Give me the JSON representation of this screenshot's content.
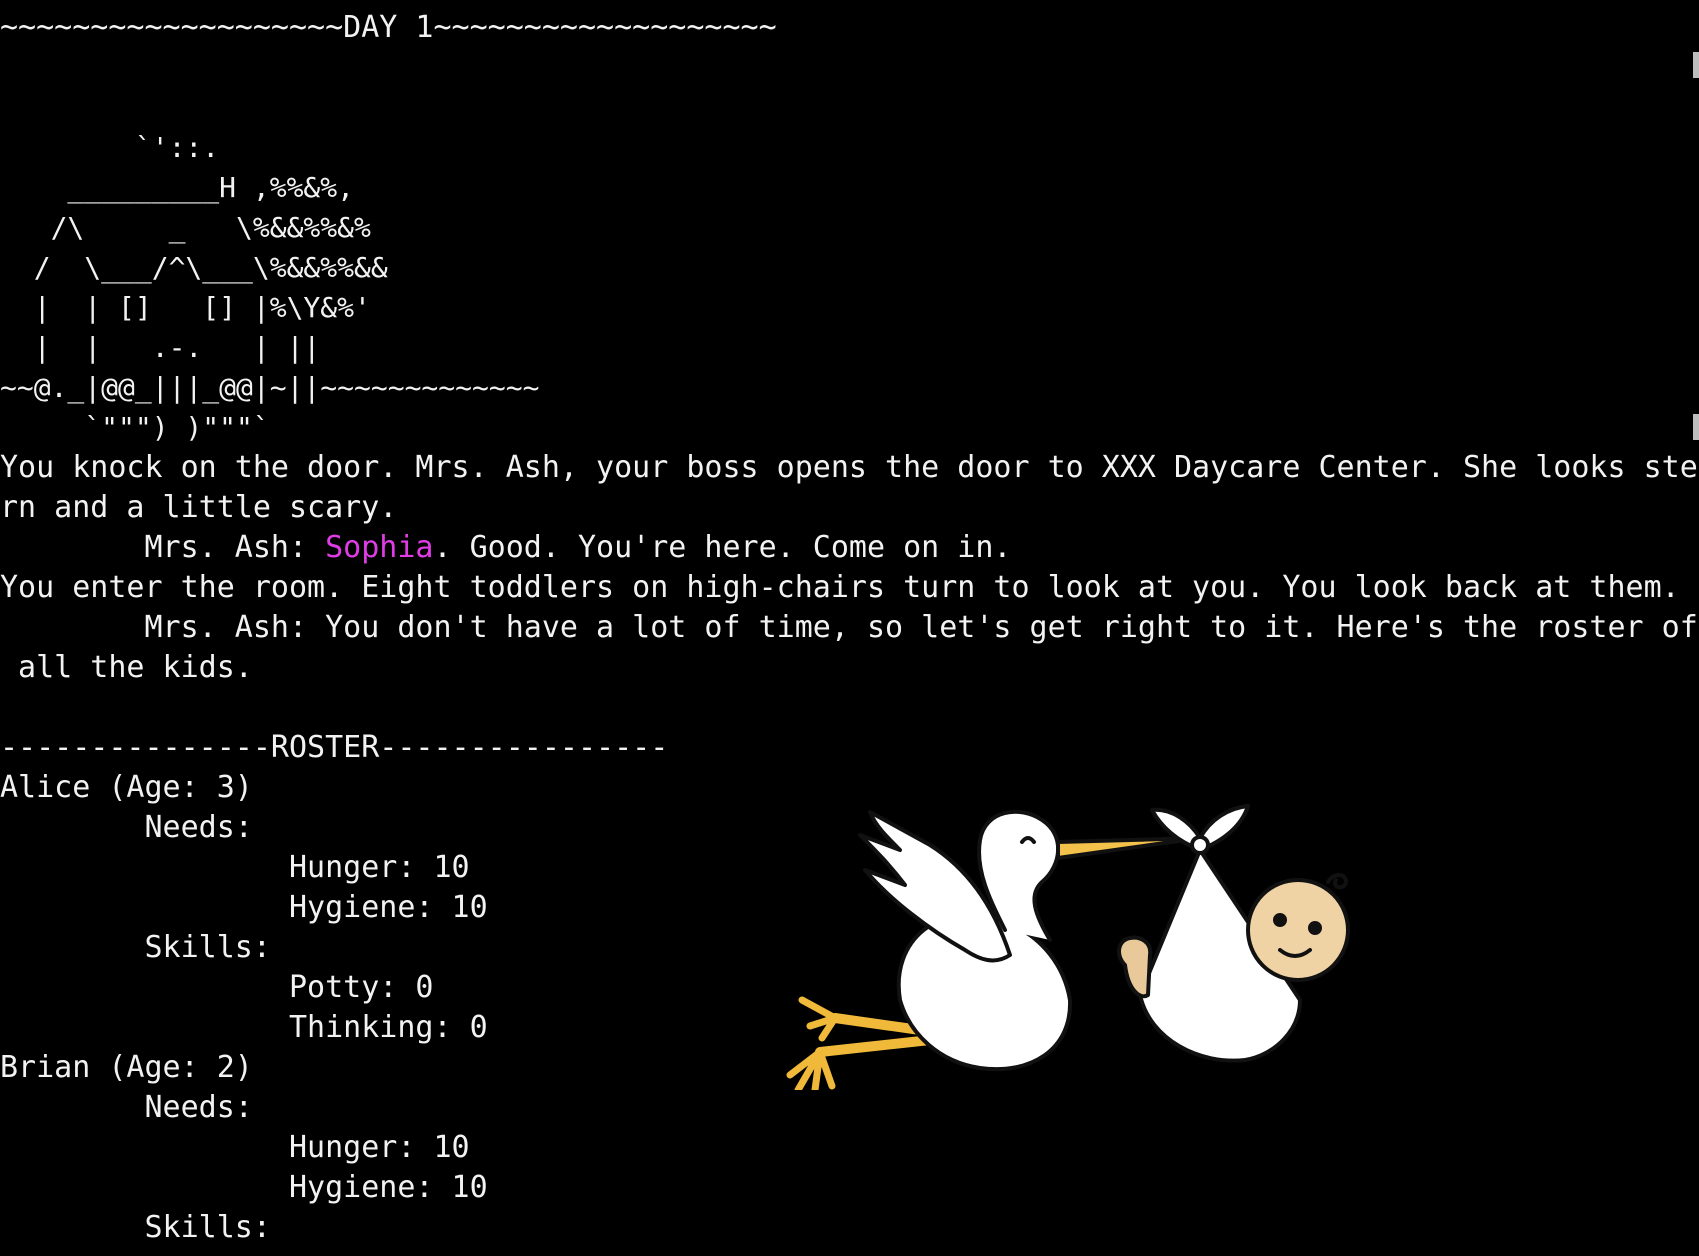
{
  "terminal": {
    "day_header": "~~~~~~~~~~~~~~~~~~~DAY 1~~~~~~~~~~~~~~~~~~~",
    "ascii_art": [
      "        `'::.",
      "    _________H ,%%&%,",
      "   /\\     _   \\%&&%%&%",
      "  /  \\___/^\\___\\%&&%%&&",
      "  |  | []   [] |%\\Y&%'",
      "  |  |   .-.   | ||",
      "~~@._|@@_|||_@@|~||~~~~~~~~~~~~~",
      "     `\"\"\") )\"\"\"`"
    ],
    "intro_line_1": "You knock on the door. Mrs. Ash, your boss opens the door to XXX Daycare Center. She looks ste",
    "intro_line_2": "rn and a little scary.",
    "greeting": {
      "prefix": "        Mrs. Ash: ",
      "player_name": "Sophia",
      "suffix": ". Good. You're here. Come on in."
    },
    "enter_line": "You enter the room. Eight toddlers on high-chairs turn to look at you. You look back at them. ",
    "roster_intro_1": "        Mrs. Ash: You don't have a lot of time, so let's get right to it. Here's the roster of",
    "roster_intro_2": " all the kids.",
    "roster_header": "---------------ROSTER----------------",
    "roster": [
      {
        "name_line": "Alice (Age: 3)",
        "needs_label": "        Needs:",
        "hunger": "                Hunger: 10",
        "hygiene": "                Hygiene: 10",
        "skills_label": "        Skills:",
        "potty": "                Potty: 0",
        "thinking": "                Thinking: 0"
      },
      {
        "name_line": "Brian (Age: 2)",
        "needs_label": "        Needs:",
        "hunger": "                Hunger: 10",
        "hygiene": "                Hygiene: 10",
        "skills_label": "        Skills:"
      }
    ]
  },
  "colors": {
    "background": "#000000",
    "text": "#f2f2f2",
    "player_name": "#e03ce6"
  },
  "icons": {
    "illustration": "stork-carrying-baby"
  }
}
